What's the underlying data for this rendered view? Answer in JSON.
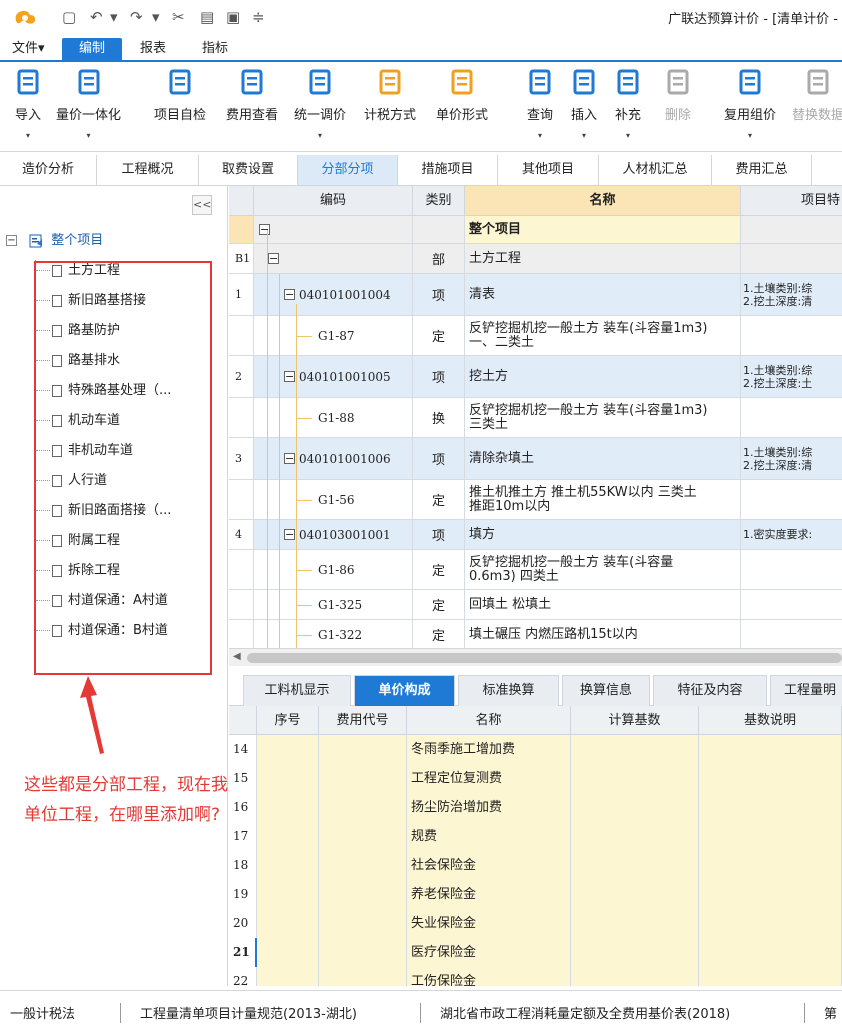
{
  "window": {
    "title": "广联达预算计价 - [清单计价 -",
    "quick_access": [
      "▢",
      "↶",
      "▾",
      "↷",
      "▾",
      "✂",
      "▤",
      "▣",
      "≑"
    ]
  },
  "menu": [
    {
      "label": "文件▾",
      "active": false
    },
    {
      "label": "编制",
      "active": true
    },
    {
      "label": "报表",
      "active": false
    },
    {
      "label": "指标",
      "active": false
    }
  ],
  "ribbon": [
    {
      "label": "导入",
      "icon": "import-icon",
      "caret": true,
      "disabled": false,
      "color": "#1f7ad6"
    },
    {
      "label": "量价一体化",
      "icon": "price-integration-icon",
      "caret": true,
      "disabled": false,
      "color": "#1f7ad6"
    },
    {
      "label": "项目自检",
      "icon": "self-check-icon",
      "caret": false,
      "disabled": false,
      "color": "#1f7ad6"
    },
    {
      "label": "费用查看",
      "icon": "fee-view-icon",
      "caret": false,
      "disabled": false,
      "color": "#1f7ad6"
    },
    {
      "label": "统一调价",
      "icon": "unified-price-icon",
      "caret": true,
      "disabled": false,
      "color": "#1f7ad6"
    },
    {
      "label": "计税方式",
      "icon": "tax-method-icon",
      "caret": false,
      "disabled": false,
      "color": "#f0a020"
    },
    {
      "label": "单价形式",
      "icon": "unit-price-form-icon",
      "caret": false,
      "disabled": false,
      "color": "#f0a020"
    },
    {
      "label": "查询",
      "icon": "query-icon",
      "caret": true,
      "disabled": false,
      "color": "#1f7ad6"
    },
    {
      "label": "插入",
      "icon": "insert-icon",
      "caret": true,
      "disabled": false,
      "color": "#1f7ad6"
    },
    {
      "label": "补充",
      "icon": "supplement-icon",
      "caret": true,
      "disabled": false,
      "color": "#1f7ad6"
    },
    {
      "label": "删除",
      "icon": "delete-icon",
      "caret": false,
      "disabled": true,
      "color": "#aaaaaa"
    },
    {
      "label": "复用组价",
      "icon": "reuse-icon",
      "caret": true,
      "disabled": false,
      "color": "#1f7ad6"
    },
    {
      "label": "替换数据",
      "icon": "replace-icon",
      "caret": false,
      "disabled": true,
      "color": "#aaaaaa"
    }
  ],
  "tabs": [
    {
      "label": "造价分析",
      "active": false
    },
    {
      "label": "工程概况",
      "active": false
    },
    {
      "label": "取费设置",
      "active": false
    },
    {
      "label": "分部分项",
      "active": true
    },
    {
      "label": "措施项目",
      "active": false
    },
    {
      "label": "其他项目",
      "active": false
    },
    {
      "label": "人材机汇总",
      "active": false
    },
    {
      "label": "费用汇总",
      "active": false
    }
  ],
  "tree": {
    "collapse_label": "<<",
    "root_label": "整个项目",
    "items": [
      "土方工程",
      "新旧路基搭接",
      "路基防护",
      "路基排水",
      "特殊路基处理（...",
      "机动车道",
      "非机动车道",
      "人行道",
      "新旧路面搭接（...",
      "附属工程",
      "拆除工程",
      "村道保通：A村道",
      "村道保通：B村道"
    ]
  },
  "annotation": {
    "line1": "这些都是分部工程，现在我想添加",
    "line2": "单位工程，在哪里添加啊?"
  },
  "grid_top": {
    "headers": {
      "code": "编码",
      "type": "类别",
      "name": "名称",
      "feature": "项目特"
    },
    "whole_row": {
      "box": "−",
      "name": "整个项目"
    },
    "rows": [
      {
        "kind": "part",
        "idx": "B1",
        "code": "",
        "type": "部",
        "name": "土方工程",
        "feature": "",
        "height": 30
      },
      {
        "kind": "item",
        "idx": "1",
        "code": "040101001004",
        "type": "项",
        "name": "清表",
        "feature": "1.土壤类别:综\n2.挖土深度:清",
        "height": 42
      },
      {
        "kind": "sub",
        "idx": "",
        "code": "G1-87",
        "type": "定",
        "name": "反铲挖掘机挖一般土方 装车(斗容量1m3)\n一、二类土",
        "feature": "",
        "height": 40
      },
      {
        "kind": "item",
        "idx": "2",
        "code": "040101001005",
        "type": "项",
        "name": "挖土方",
        "feature": "1.土壤类别:综\n2.挖土深度:土",
        "height": 42
      },
      {
        "kind": "sub",
        "idx": "",
        "code": "G1-88",
        "type": "换",
        "name": "反铲挖掘机挖一般土方 装车(斗容量1m3)\n三类土",
        "feature": "",
        "height": 40
      },
      {
        "kind": "item",
        "idx": "3",
        "code": "040101001006",
        "type": "项",
        "name": "清除杂填土",
        "feature": "1.土壤类别:综\n2.挖土深度:清",
        "height": 42
      },
      {
        "kind": "sub",
        "idx": "",
        "code": "G1-56",
        "type": "定",
        "name": "推土机推土方 推土机55KW以内 三类土\n推距10m以内",
        "feature": "",
        "height": 40
      },
      {
        "kind": "item",
        "idx": "4",
        "code": "040103001001",
        "type": "项",
        "name": "填方",
        "feature": "1.密实度要求:",
        "height": 30
      },
      {
        "kind": "sub",
        "idx": "",
        "code": "G1-86",
        "type": "定",
        "name": "反铲挖掘机挖一般土方 装车(斗容量\n0.6m3) 四类土",
        "feature": "",
        "height": 40
      },
      {
        "kind": "sub",
        "idx": "",
        "code": "G1-325",
        "type": "定",
        "name": "回填土 松填土",
        "feature": "",
        "height": 30
      },
      {
        "kind": "sub",
        "idx": "",
        "code": "G1-322",
        "type": "定",
        "name": "填土碾压 内燃压路机15t以内",
        "feature": "",
        "height": 30
      }
    ]
  },
  "bottom_tabs": [
    {
      "label": "工料机显示",
      "active": false
    },
    {
      "label": "单价构成",
      "active": true
    },
    {
      "label": "标准换算",
      "active": false
    },
    {
      "label": "换算信息",
      "active": false
    },
    {
      "label": "特征及内容",
      "active": false
    },
    {
      "label": "工程量明",
      "active": false
    }
  ],
  "grid_bottom": {
    "headers": {
      "seq": "序号",
      "code": "费用代号",
      "name": "名称",
      "base": "计算基数",
      "desc": "基数说明"
    },
    "rows": [
      {
        "idx": "14",
        "name": "冬雨季施工增加费",
        "bold": false
      },
      {
        "idx": "15",
        "name": "工程定位复测费",
        "bold": false
      },
      {
        "idx": "16",
        "name": "扬尘防治增加费",
        "bold": false
      },
      {
        "idx": "17",
        "name": "规费",
        "bold": false
      },
      {
        "idx": "18",
        "name": "社会保险金",
        "bold": false
      },
      {
        "idx": "19",
        "name": "养老保险金",
        "bold": false
      },
      {
        "idx": "20",
        "name": "失业保险金",
        "bold": false
      },
      {
        "idx": "21",
        "name": "医疗保险金",
        "bold": true
      },
      {
        "idx": "22",
        "name": "工伤保险金",
        "bold": false
      }
    ]
  },
  "status": [
    "一般计税法",
    "工程量清单项目计量规范(2013-湖北)",
    "湖北省市政工程消耗量定额及全费用基价表(2018)",
    "第"
  ]
}
